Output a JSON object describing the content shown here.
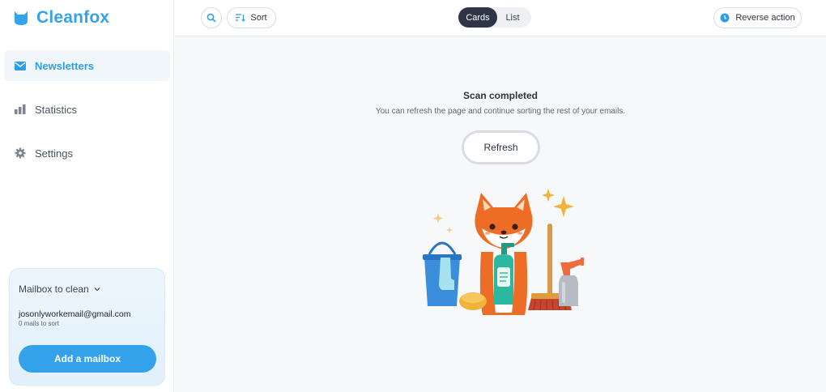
{
  "app": {
    "name": "Cleanfox",
    "brand_color": "#35a3e8"
  },
  "sidebar": {
    "items": [
      {
        "label": "Newsletters",
        "icon": "envelope-icon",
        "active": true
      },
      {
        "label": "Statistics",
        "icon": "bar-chart-icon",
        "active": false
      },
      {
        "label": "Settings",
        "icon": "gear-icon",
        "active": false
      }
    ],
    "mailbox": {
      "title": "Mailbox to clean",
      "email": "josonlyworkemail@gmail.com",
      "subtitle": "0 mails to sort",
      "add_label": "Add a mailbox"
    }
  },
  "toolbar": {
    "search_icon": "search-icon",
    "sort_label": "Sort",
    "view_options": [
      "Cards",
      "List"
    ],
    "selected_view": "Cards",
    "reverse_label": "Reverse action"
  },
  "main": {
    "title": "Scan completed",
    "message": "You can refresh the page and continue sorting the rest of your emails.",
    "refresh_label": "Refresh",
    "illustration": "fox-cleaning-illustration"
  }
}
